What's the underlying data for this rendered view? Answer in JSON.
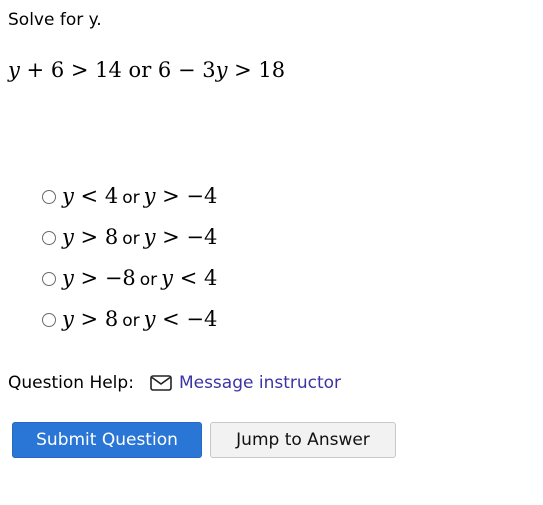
{
  "question": {
    "prompt": "Solve for y.",
    "equation": {
      "left": {
        "var": "y",
        "rest": " + 6 > 14"
      },
      "connector": "or",
      "right": {
        "pre": "6 − 3",
        "var": "y",
        "rest": " > 18"
      }
    }
  },
  "choices": [
    {
      "a_var": "y",
      "a_rest": " < 4",
      "or": "or",
      "b_var": "y",
      "b_rest": " > −4",
      "selected": false
    },
    {
      "a_var": "y",
      "a_rest": " > 8",
      "or": "or",
      "b_var": "y",
      "b_rest": " > −4",
      "selected": false
    },
    {
      "a_var": "y",
      "a_rest": " > −8",
      "or": "or",
      "b_var": "y",
      "b_rest": " < 4",
      "selected": false
    },
    {
      "a_var": "y",
      "a_rest": " > 8",
      "or": "or",
      "b_var": "y",
      "b_rest": " < −4",
      "selected": false
    }
  ],
  "help": {
    "label": "Question Help:",
    "icon": "mail-icon",
    "link_label": "Message instructor",
    "link_color": "#3b34a6"
  },
  "buttons": {
    "submit_label": "Submit Question",
    "submit_color": "#2a76d6",
    "jump_label": "Jump to Answer"
  }
}
